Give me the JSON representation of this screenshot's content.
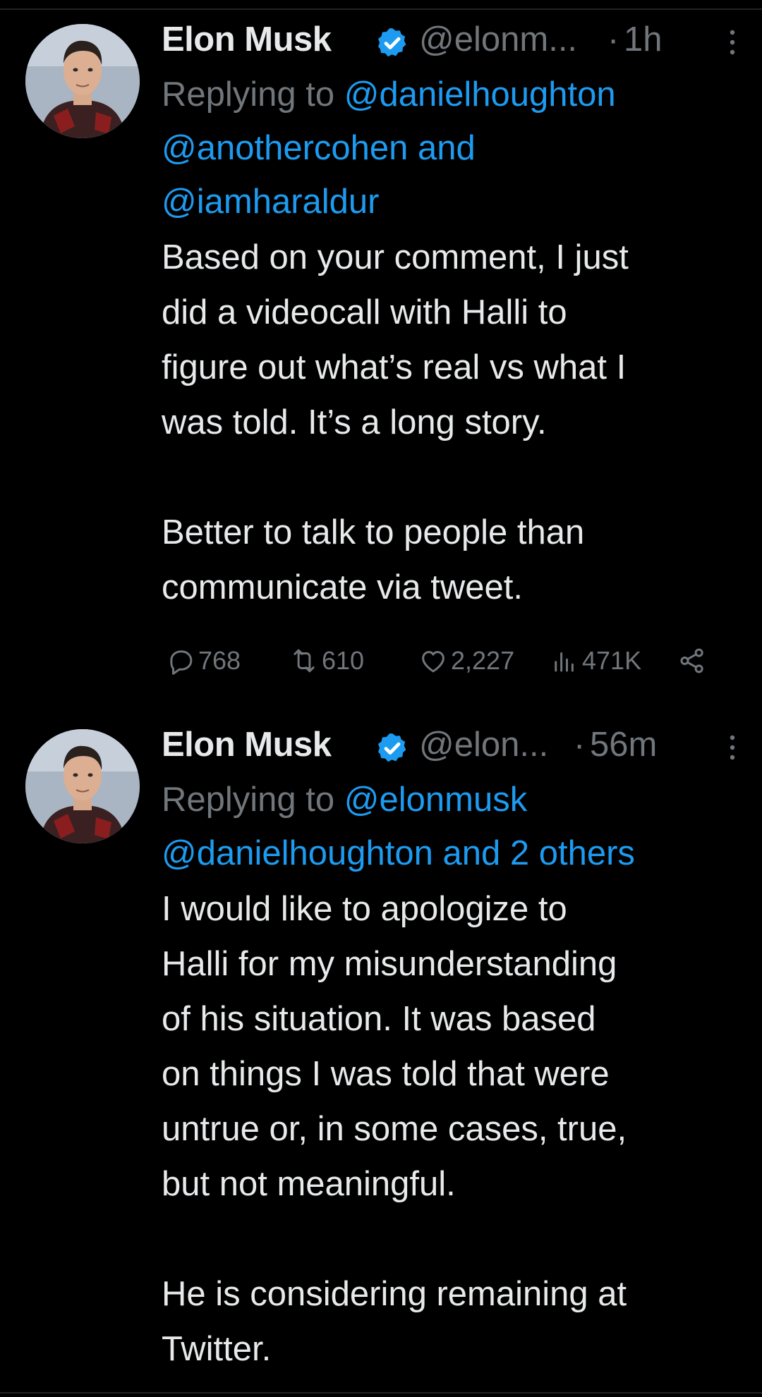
{
  "tweets": [
    {
      "author_name": "Elon Musk",
      "handle": "@elonm...",
      "time": "1h",
      "replying_prefix": "Replying to",
      "reply_to_line1": "@danielhoughton",
      "reply_to_line2": "@anothercohen and",
      "reply_to_line3": "@iamharaldur",
      "body_lines_p1": [
        "Based on your comment, I just",
        "did a videocall with Halli to",
        "figure out what’s real vs what I",
        "was told. It’s a long story."
      ],
      "body_lines_p2": [
        "Better to talk to people than",
        "communicate via tweet."
      ],
      "stats": {
        "replies": "768",
        "retweets": "610",
        "likes": "2,227",
        "views": "471K"
      }
    },
    {
      "author_name": "Elon Musk",
      "handle": "@elon...",
      "time": "56m",
      "replying_prefix": "Replying to",
      "reply_to_line1": "@elonmusk",
      "reply_to_line2": "@danielhoughton and 2 others",
      "body_lines_p1": [
        "I would like to apologize to",
        "Halli for my misunderstanding",
        "of his situation. It was based",
        "on things I was told that were",
        "untrue or, in some cases, true,",
        "but not meaningful."
      ],
      "body_lines_p2": [
        "He is considering remaining at",
        "Twitter."
      ]
    }
  ],
  "icons": {
    "verified": "verified-badge-icon",
    "more": "more-vertical-icon",
    "reply": "reply-bubble-icon",
    "retweet": "retweet-icon",
    "like": "heart-icon",
    "views": "views-bar-chart-icon",
    "share": "share-icon"
  },
  "colors": {
    "background": "#000000",
    "text": "#e7e9ea",
    "muted": "#71767b",
    "link": "#1d9bf0",
    "verified": "#1d9bf0"
  }
}
